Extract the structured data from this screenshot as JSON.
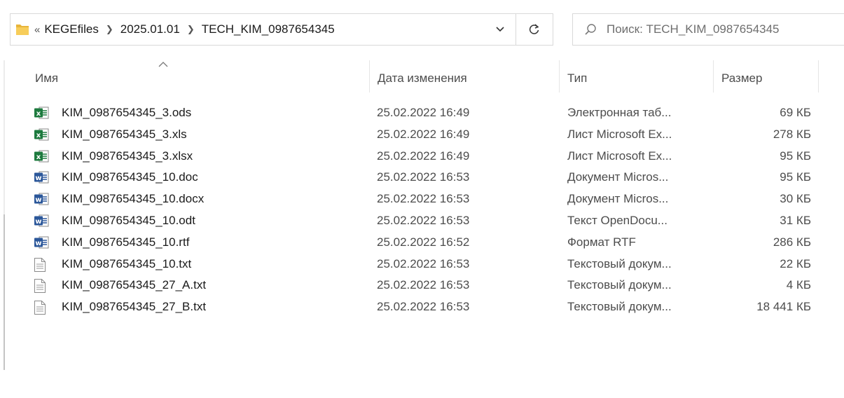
{
  "address": {
    "overflow": "«",
    "crumbs": [
      "KEGEfiles",
      "2025.01.01",
      "TECH_KIM_0987654345"
    ]
  },
  "search": {
    "placeholder": "Поиск: TECH_KIM_0987654345"
  },
  "columns": {
    "name": "Имя",
    "date": "Дата изменения",
    "type": "Тип",
    "size": "Размер"
  },
  "colors": {
    "excel": "#1d7a3e",
    "excel_old": "#2a8f4a",
    "word": "#2b579a",
    "word_old": "#2f62b8",
    "folder": "#f4c542"
  },
  "files": [
    {
      "icon": "ods-spreadsheet-icon",
      "name": "KIM_0987654345_3.ods",
      "date": "25.02.2022 16:49",
      "type": "Электронная таб...",
      "size": "69 КБ"
    },
    {
      "icon": "xls-spreadsheet-icon",
      "name": "KIM_0987654345_3.xls",
      "date": "25.02.2022 16:49",
      "type": "Лист Microsoft Ex...",
      "size": "278 КБ"
    },
    {
      "icon": "xlsx-spreadsheet-icon",
      "name": "KIM_0987654345_3.xlsx",
      "date": "25.02.2022 16:49",
      "type": "Лист Microsoft Ex...",
      "size": "95 КБ"
    },
    {
      "icon": "doc-document-icon",
      "name": "KIM_0987654345_10.doc",
      "date": "25.02.2022 16:53",
      "type": "Документ Micros...",
      "size": "95 КБ"
    },
    {
      "icon": "docx-document-icon",
      "name": "KIM_0987654345_10.docx",
      "date": "25.02.2022 16:53",
      "type": "Документ Micros...",
      "size": "30 КБ"
    },
    {
      "icon": "odt-document-icon",
      "name": "KIM_0987654345_10.odt",
      "date": "25.02.2022 16:53",
      "type": "Текст OpenDocu...",
      "size": "31 КБ"
    },
    {
      "icon": "rtf-document-icon",
      "name": "KIM_0987654345_10.rtf",
      "date": "25.02.2022 16:52",
      "type": "Формат RTF",
      "size": "286 КБ"
    },
    {
      "icon": "txt-file-icon",
      "name": "KIM_0987654345_10.txt",
      "date": "25.02.2022 16:53",
      "type": "Текстовый докум...",
      "size": "22 КБ"
    },
    {
      "icon": "txt-file-icon",
      "name": "KIM_0987654345_27_A.txt",
      "date": "25.02.2022 16:53",
      "type": "Текстовый докум...",
      "size": "4 КБ"
    },
    {
      "icon": "txt-file-icon",
      "name": "KIM_0987654345_27_B.txt",
      "date": "25.02.2022 16:53",
      "type": "Текстовый докум...",
      "size": "18 441 КБ"
    }
  ]
}
